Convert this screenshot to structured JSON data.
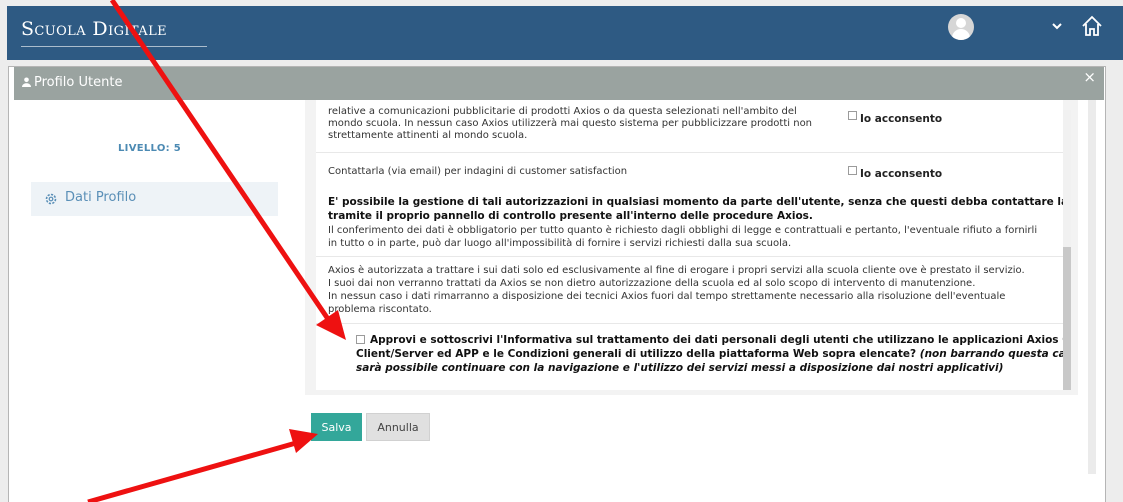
{
  "header": {
    "brand": "Scuola Digitale",
    "chevron_icon": "chevron-down-icon",
    "home_icon": "home-icon"
  },
  "modal": {
    "title": "Profilo Utente",
    "close": "×",
    "level": "LIVELLO: 5",
    "sidebar_item": "Dati Profilo"
  },
  "content": {
    "para1_l1": "relative a comunicazioni pubblicitarie di prodotti Axios o da questa selezionati nell'ambito del",
    "para1_l2": "mondo scuola. In nessun caso Axios utilizzerà mai questo sistema per pubblicizzare prodotti non",
    "para1_l3": "strettamente attinenti al mondo scuola.",
    "consent1": "Io acconsento",
    "para2": "Contattarla (via email) per indagini di customer satisfaction",
    "consent2": "Io acconsento",
    "bold1": "E' possibile la gestione di tali autorizzazioni in qualsiasi momento da parte dell'utente, senza che questi debba contattare la Axios,",
    "bold2": "tramite il proprio pannello di controllo presente all'interno delle procedure Axios.",
    "para3_l1": "Il conferimento dei dati è obbligatorio per tutto quanto è richiesto dagli obblighi di legge e contrattuali e pertanto, l'eventuale rifiuto a fornirli",
    "para3_l2": "in tutto o in parte, può dar luogo all'impossibilità di fornire i servizi richiesti dalla sua scuola.",
    "para4_l1": "Axios è autorizzata a trattare i sui dati solo ed esclusivamente al fine di erogare i propri servizi alla scuola cliente ove è prestato il servizio.",
    "para4_l2": "I suoi dai non verranno trattati da Axios se non dietro autorizzazione della scuola ed al solo scopo di intervento di manutenzione.",
    "para4_l3": "In nessun caso i dati rimarranno a disposizione dei tecnici Axios fuori dal tempo strettamente necessario alla risoluzione dell'eventuale",
    "para4_l4": "problema riscontato.",
    "approval_l1": "Approvi e sottoscrivi l'Informativa sul trattamento dei dati personali degli utenti che utilizzano le applicazioni Axios Cloud,",
    "approval_l2": "Client/Server ed APP e le Condizioni generali di utilizzo della piattaforma Web sopra elencate?",
    "approval_l2_italic": " (non barrando questa casella non",
    "approval_l3_italic": "sarà possibile continuare con la navigazione e l'utilizzo dei servizi messi a disposizione dai nostri applicativi)"
  },
  "buttons": {
    "save": "Salva",
    "cancel": "Annulla"
  },
  "colors": {
    "navbar": "#2e5a83",
    "modal_header": "#9aa3a0",
    "save": "#33a79a",
    "arrow": "#ee1111"
  }
}
